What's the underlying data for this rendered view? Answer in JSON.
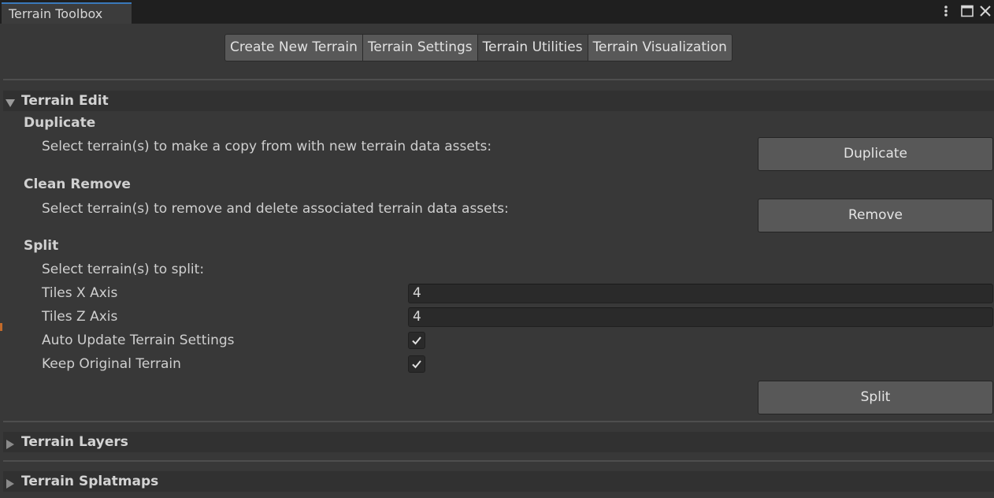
{
  "window": {
    "tab_title": "Terrain Toolbox",
    "controls": [
      "more-options-icon",
      "maximize-icon",
      "close-icon"
    ]
  },
  "toolbar": {
    "tabs": [
      {
        "label": "Create New Terrain",
        "active": false
      },
      {
        "label": "Terrain Settings",
        "active": false
      },
      {
        "label": "Terrain Utilities",
        "active": true
      },
      {
        "label": "Terrain Visualization",
        "active": false
      }
    ]
  },
  "terrain_edit": {
    "title": "Terrain Edit",
    "expanded": true,
    "duplicate": {
      "title": "Duplicate",
      "description": "Select terrain(s) to make a copy from with new terrain data assets:",
      "button": "Duplicate"
    },
    "clean_remove": {
      "title": "Clean Remove",
      "description": "Select terrain(s) to remove and delete associated terrain data assets:",
      "button": "Remove"
    },
    "split": {
      "title": "Split",
      "description": "Select terrain(s) to split:",
      "tiles_x_label": "Tiles X Axis",
      "tiles_x_value": "4",
      "tiles_z_label": "Tiles Z Axis",
      "tiles_z_value": "4",
      "auto_update_label": "Auto Update Terrain Settings",
      "auto_update_checked": true,
      "keep_original_label": "Keep Original Terrain",
      "keep_original_checked": true,
      "button": "Split"
    }
  },
  "terrain_layers": {
    "title": "Terrain Layers",
    "expanded": false
  },
  "terrain_splatmaps": {
    "title": "Terrain Splatmaps",
    "expanded": false
  },
  "colors": {
    "background": "#383838",
    "tab_strip": "#1f1f1f",
    "accent": "#3a79bb",
    "button": "#585858",
    "field": "#2a2a2a"
  }
}
